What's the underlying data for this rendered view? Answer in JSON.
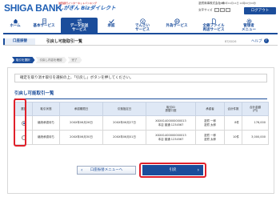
{
  "header": {
    "logo": "SHIGA BANK",
    "service_sub": "滋賀銀行インターネットバンキング",
    "service_main": "しがぎん Bizダイレクト",
    "user_name": "滋賀商事株式会社 様",
    "login_time": "20XX年04月14日 10時00分00秒",
    "text_size_label": "文字サイズ",
    "logout_label": "ログアウト"
  },
  "nav": {
    "items": [
      {
        "label": "ホーム",
        "icon": "home-icon"
      },
      {
        "label": "基本サービス",
        "icon": "document-icon"
      },
      {
        "label": "データ伝送\nサービス",
        "icon": "transfer-icon"
      },
      {
        "label": "承認",
        "icon": "check-icon"
      },
      {
        "label": "でんさい\nサービス",
        "icon": "yen-icon"
      },
      {
        "label": "外為サービス",
        "icon": "globe-icon"
      },
      {
        "label": "全銀ファイル\n再送サービス",
        "icon": "file-icon"
      },
      {
        "label": "管理者\nメニュー",
        "icon": "gear-icon"
      }
    ],
    "active_index": 2
  },
  "title_row": {
    "category": "口座振替",
    "page_title": "引戻し可能取引一覧",
    "screen_id": "BTJS026",
    "help_label": "ヘルプ"
  },
  "steps": [
    "取引を選択",
    "引戻し内容を確認",
    "完了"
  ],
  "message": "確定を取り消す取引を選択の上、「引戻し」ボタンを押してください。",
  "section_title": "引戻し可能取引一覧",
  "table": {
    "headers": [
      "選択",
      "取引状態",
      "承認期限日",
      "引落指定日",
      "取引ID\n振替口座",
      "承認者",
      "合計件数",
      "合計金額\n(円)"
    ],
    "rows": [
      {
        "selected": true,
        "status": "継続承認待ち",
        "approval_deadline": "20XX年06月26日",
        "debit_date": "20XX年06月27日",
        "transaction_id": "XXXX1400000000013",
        "account": "本店 普通 1234567",
        "approver": "滋賀 一郎\n滋賀 太郎",
        "count": "8件",
        "amount": "176,000"
      },
      {
        "selected": false,
        "status": "継続承認待ち",
        "approval_deadline": "20XX年06月30日",
        "debit_date": "20XX年06月01日",
        "transaction_id": "XXXX1400000000013",
        "account": "本店 普通 1234567",
        "approver": "滋賀 一郎\n滋賀 太郎",
        "count": "10件",
        "amount": "3,000,000"
      }
    ]
  },
  "buttons": {
    "back": "口座振替メニューへ",
    "next": "引戻"
  }
}
